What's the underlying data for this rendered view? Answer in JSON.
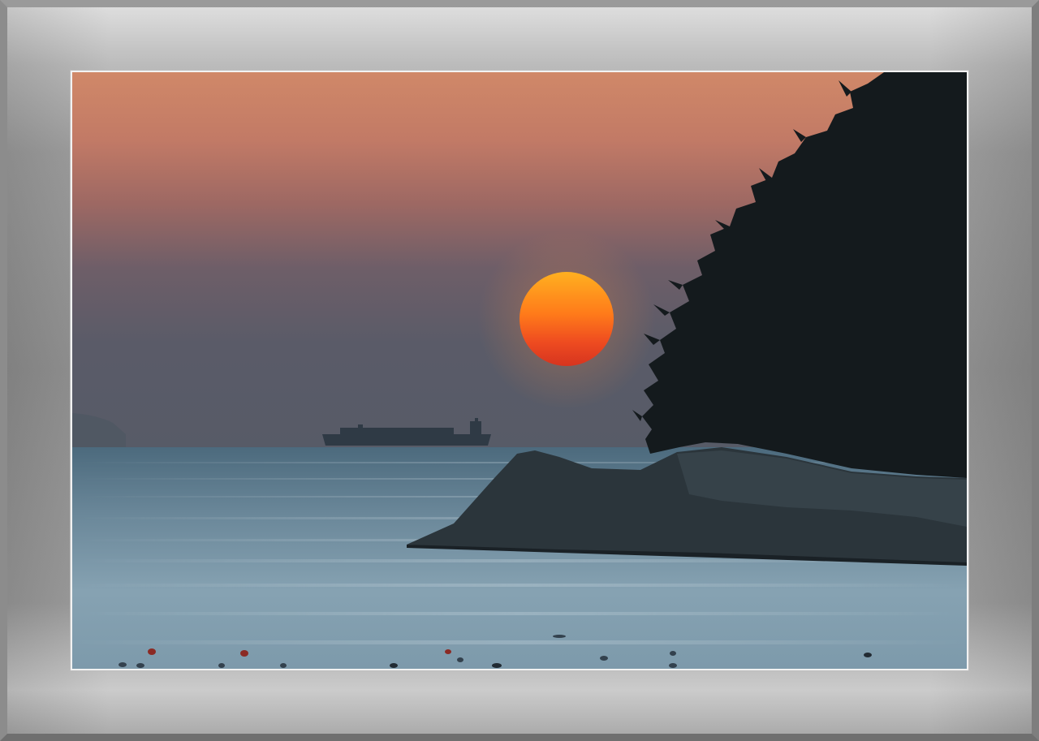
{
  "scene": {
    "subject": "sunset-over-sea",
    "colors": {
      "sky_top": "#d28a6a",
      "sky_mid": "#a86a62",
      "haze": "#5e5c68",
      "sea": "#6f8fa3",
      "sun_top": "#ffb21f",
      "sun_bottom": "#e63a1f",
      "silhouette": "#141a1d",
      "rock": "#2a3338",
      "frame": "#9a9a9a",
      "mat_border": "#f2f2f2"
    }
  }
}
